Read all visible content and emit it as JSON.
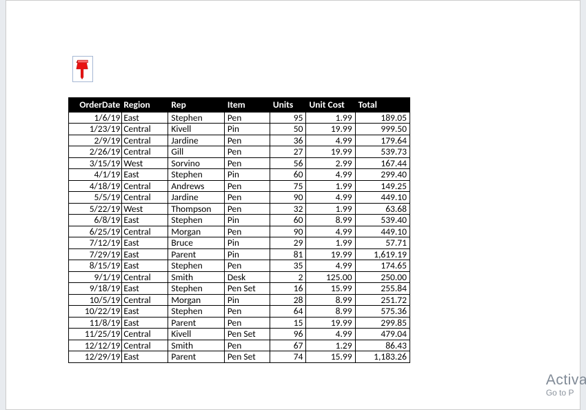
{
  "icon": {
    "name": "pushpin"
  },
  "columns": {
    "orderdate": "OrderDate",
    "region": "Region",
    "rep": "Rep",
    "item": "Item",
    "units": "Units",
    "unitcost": "Unit Cost",
    "total": "Total"
  },
  "rows": [
    {
      "orderdate": "1/6/19",
      "region": "East",
      "rep": "Stephen",
      "item": "Pen",
      "units": "95",
      "unitcost": "1.99",
      "total": "189.05"
    },
    {
      "orderdate": "1/23/19",
      "region": "Central",
      "rep": "Kivell",
      "item": "Pin",
      "units": "50",
      "unitcost": "19.99",
      "total": "999.50"
    },
    {
      "orderdate": "2/9/19",
      "region": "Central",
      "rep": "Jardine",
      "item": "Pen",
      "units": "36",
      "unitcost": "4.99",
      "total": "179.64"
    },
    {
      "orderdate": "2/26/19",
      "region": "Central",
      "rep": "Gill",
      "item": "Pen",
      "units": "27",
      "unitcost": "19.99",
      "total": "539.73"
    },
    {
      "orderdate": "3/15/19",
      "region": "West",
      "rep": "Sorvino",
      "item": "Pen",
      "units": "56",
      "unitcost": "2.99",
      "total": "167.44"
    },
    {
      "orderdate": "4/1/19",
      "region": "East",
      "rep": "Stephen",
      "item": "Pin",
      "units": "60",
      "unitcost": "4.99",
      "total": "299.40"
    },
    {
      "orderdate": "4/18/19",
      "region": "Central",
      "rep": "Andrews",
      "item": "Pen",
      "units": "75",
      "unitcost": "1.99",
      "total": "149.25"
    },
    {
      "orderdate": "5/5/19",
      "region": "Central",
      "rep": "Jardine",
      "item": "Pen",
      "units": "90",
      "unitcost": "4.99",
      "total": "449.10"
    },
    {
      "orderdate": "5/22/19",
      "region": "West",
      "rep": "Thompson",
      "item": "Pen",
      "units": "32",
      "unitcost": "1.99",
      "total": "63.68"
    },
    {
      "orderdate": "6/8/19",
      "region": "East",
      "rep": "Stephen",
      "item": "Pin",
      "units": "60",
      "unitcost": "8.99",
      "total": "539.40"
    },
    {
      "orderdate": "6/25/19",
      "region": "Central",
      "rep": "Morgan",
      "item": "Pen",
      "units": "90",
      "unitcost": "4.99",
      "total": "449.10"
    },
    {
      "orderdate": "7/12/19",
      "region": "East",
      "rep": "Bruce",
      "item": "Pin",
      "units": "29",
      "unitcost": "1.99",
      "total": "57.71"
    },
    {
      "orderdate": "7/29/19",
      "region": "East",
      "rep": "Parent",
      "item": "Pin",
      "units": "81",
      "unitcost": "19.99",
      "total": "1,619.19"
    },
    {
      "orderdate": "8/15/19",
      "region": "East",
      "rep": "Stephen",
      "item": "Pen",
      "units": "35",
      "unitcost": "4.99",
      "total": "174.65"
    },
    {
      "orderdate": "9/1/19",
      "region": "Central",
      "rep": "Smith",
      "item": "Desk",
      "units": "2",
      "unitcost": "125.00",
      "total": "250.00"
    },
    {
      "orderdate": "9/18/19",
      "region": "East",
      "rep": "Stephen",
      "item": "Pen Set",
      "units": "16",
      "unitcost": "15.99",
      "total": "255.84"
    },
    {
      "orderdate": "10/5/19",
      "region": "Central",
      "rep": "Morgan",
      "item": "Pin",
      "units": "28",
      "unitcost": "8.99",
      "total": "251.72"
    },
    {
      "orderdate": "10/22/19",
      "region": "East",
      "rep": "Stephen",
      "item": "Pen",
      "units": "64",
      "unitcost": "8.99",
      "total": "575.36"
    },
    {
      "orderdate": "11/8/19",
      "region": "East",
      "rep": "Parent",
      "item": "Pen",
      "units": "15",
      "unitcost": "19.99",
      "total": "299.85"
    },
    {
      "orderdate": "11/25/19",
      "region": "Central",
      "rep": "Kivell",
      "item": "Pen Set",
      "units": "96",
      "unitcost": "4.99",
      "total": "479.04"
    },
    {
      "orderdate": "12/12/19",
      "region": "Central",
      "rep": "Smith",
      "item": "Pen",
      "units": "67",
      "unitcost": "1.29",
      "total": "86.43"
    },
    {
      "orderdate": "12/29/19",
      "region": "East",
      "rep": "Parent",
      "item": "Pen Set",
      "units": "74",
      "unitcost": "15.99",
      "total": "1,183.26"
    }
  ],
  "watermark": {
    "line1": "Activa",
    "line2": "Go to P"
  }
}
